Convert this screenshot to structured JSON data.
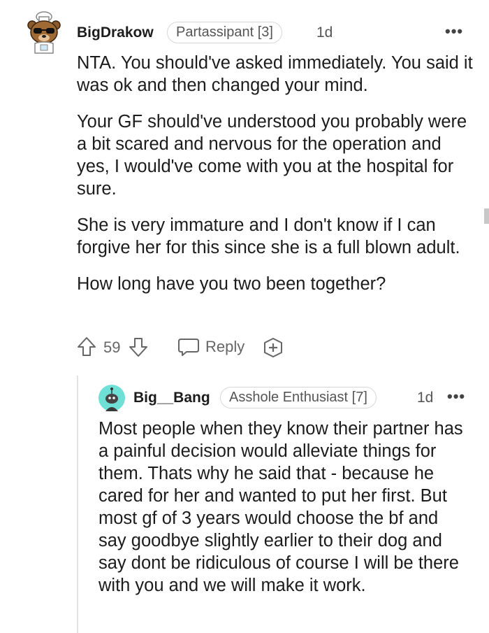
{
  "comment": {
    "username": "BigDrakow",
    "flair": "Partassipant [3]",
    "time": "1d",
    "more": "•••",
    "paragraphs": [
      "NTA. You should've asked immediately. You said it was ok and then changed your mind.",
      "Your GF should've understood you probably were a bit scared and nervous for the operation and yes, I would've come with you at the hospital for sure.",
      "She is very immature and I don't know if I can forgive her for this since she is a full blown adult.",
      "How long have you two been together?"
    ],
    "votes": "59",
    "reply_label": "Reply"
  },
  "reply": {
    "username": "Big__Bang",
    "flair": "Asshole Enthusiast [7]",
    "time": "1d",
    "more": "•••",
    "text": "Most people when they know their partner has a painful decision would alleviate things for them. Thats why he said that - because he cared for her and wanted to put her first. But most gf of 3 years would choose the bf and say goodbye slightly earlier to their dog and say dont be ridiculous of course I will be there with you and we will make it work."
  },
  "colors": {
    "text": "#1c1c1c",
    "meta": "#555555",
    "border": "#d7d7d7",
    "avatar_bg": "#6fe0d5"
  },
  "icons": [
    "avatar-bear-icon",
    "upvote-icon",
    "downvote-icon",
    "comment-bubble-icon",
    "award-plus-icon",
    "avatar-snoo-icon"
  ]
}
